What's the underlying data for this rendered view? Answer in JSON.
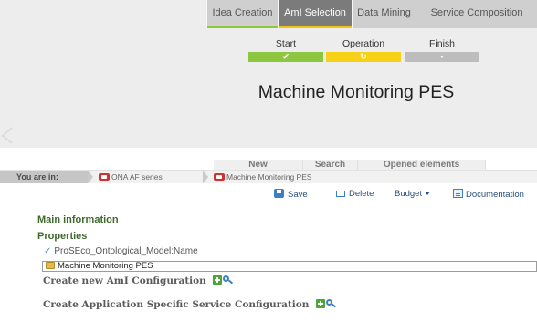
{
  "phase_tabs": [
    {
      "label": "Idea Creation",
      "active": false,
      "underline": "#8dc63f"
    },
    {
      "label": "AmI Selection",
      "active": true,
      "underline": "#f1c40f"
    },
    {
      "label": "Data Mining",
      "active": false,
      "underline": ""
    },
    {
      "label": "Service Composition",
      "active": false,
      "underline": ""
    }
  ],
  "progress": {
    "steps": [
      {
        "label": "Start",
        "mark": "✔",
        "color": "#8dc63f"
      },
      {
        "label": "Operation",
        "mark": "↻",
        "color": "#f7d117"
      },
      {
        "label": "Finish",
        "mark": "•",
        "color": "#bdbdbd"
      }
    ]
  },
  "page_title": "Machine Monitoring PES",
  "nav_tabs": [
    {
      "label": "New"
    },
    {
      "label": "Search"
    },
    {
      "label": "Opened elements"
    }
  ],
  "breadcrumb": {
    "prefix": "You are in:",
    "items": [
      "ONA AF series",
      "Machine Monitoring PES"
    ]
  },
  "toolbar": {
    "save": "Save",
    "delete": "Delete",
    "budget": "Budget",
    "documentation": "Documentation"
  },
  "main": {
    "section_main": "Main information",
    "section_properties": "Properties",
    "property_label": "ProSEco_Ontological_Model:Name",
    "name_value": "Machine Monitoring PES",
    "create_ami": "Create new AmI Configuration",
    "create_app": "Create Application Specific Service Configuration"
  },
  "colors": {
    "accent_green": "#8dc63f",
    "accent_yellow": "#f1c40f",
    "section_green": "#3e6a2c",
    "link_blue": "#2a4f7a"
  }
}
